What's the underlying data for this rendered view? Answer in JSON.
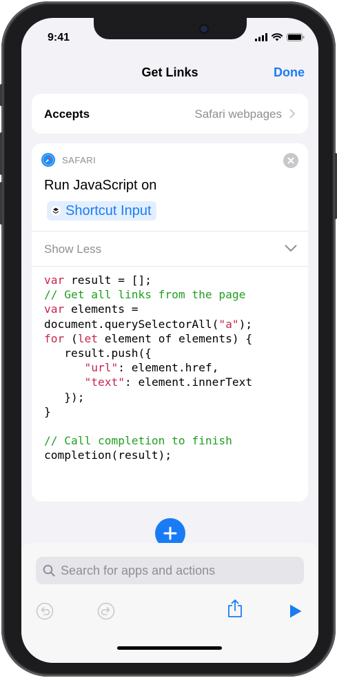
{
  "status": {
    "time": "9:41"
  },
  "nav": {
    "title": "Get Links",
    "done_label": "Done"
  },
  "accepts": {
    "label": "Accepts",
    "value": "Safari webpages"
  },
  "action": {
    "app_label": "SAFARI",
    "title": "Run JavaScript on",
    "input_token": "Shortcut Input",
    "toggle_label": "Show Less"
  },
  "code": {
    "lines": [
      "var result = [];",
      "// Get all links from the page",
      "var elements =",
      "document.querySelectorAll(\"a\");",
      "for (let element of elements) {",
      "   result.push({",
      "      \"url\": element.href,",
      "      \"text\": element.innerText",
      "   });",
      "}",
      "",
      "// Call completion to finish",
      "completion(result);"
    ]
  },
  "search": {
    "placeholder": "Search for apps and actions"
  },
  "colors": {
    "accent": "#1a7cf5",
    "keyword": "#c7254e",
    "comment": "#1f9e1f"
  },
  "icons": [
    "safari-icon",
    "close-icon",
    "chevron-right-icon",
    "chevron-down-icon",
    "layers-icon",
    "plus-icon",
    "search-icon",
    "undo-icon",
    "redo-icon",
    "share-icon",
    "play-icon"
  ]
}
